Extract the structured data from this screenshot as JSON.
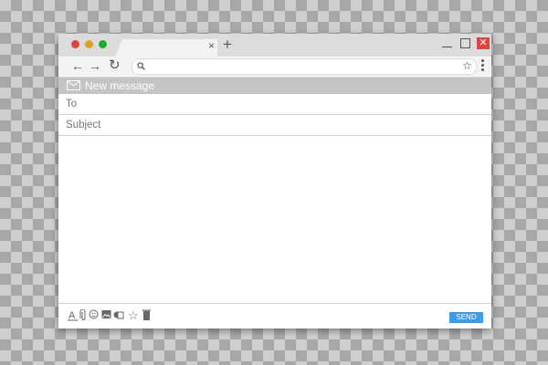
{
  "browser": {
    "tab": {
      "close_glyph": "×",
      "close_icon": "close-icon"
    },
    "new_tab_glyph": "+",
    "window_controls": {
      "close_glyph": "✕"
    },
    "toolbar": {
      "back_glyph": "←",
      "forward_glyph": "→",
      "reload_glyph": "↻",
      "address_value": "",
      "address_placeholder": "",
      "bookmark_glyph": "☆"
    }
  },
  "compose": {
    "title": "New message",
    "to_label": "To",
    "subject_label": "Subject",
    "body_text": ""
  },
  "footer": {
    "icons": [
      {
        "name": "text-format-icon",
        "glyph": "A"
      },
      {
        "name": "attach-icon",
        "glyph": ""
      },
      {
        "name": "emoji-icon",
        "glyph": "☺"
      },
      {
        "name": "image-icon",
        "glyph": ""
      },
      {
        "name": "drive-icon",
        "glyph": ""
      },
      {
        "name": "star-icon",
        "glyph": "☆"
      },
      {
        "name": "trash-icon",
        "glyph": ""
      }
    ],
    "send_label": "SEND"
  },
  "colors": {
    "traffic_red": "#e0443e",
    "traffic_yellow": "#dea123",
    "traffic_green": "#1aab29",
    "send_button": "#3d9be9",
    "header_bar": "#c4c4c4"
  }
}
